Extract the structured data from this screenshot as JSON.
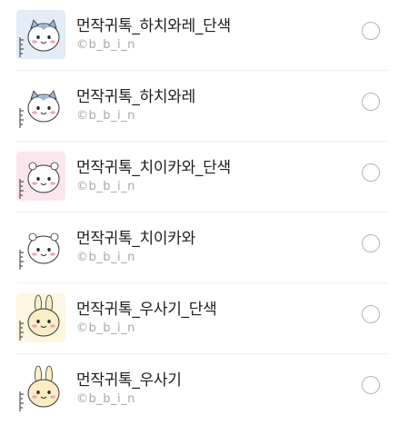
{
  "list": {
    "items": [
      {
        "title": "먼작귀톡_하치와레_단색",
        "author": "©b_b_i_n",
        "character": "hachiware",
        "thumb_bg": "#e3ecf7",
        "selected": false
      },
      {
        "title": "먼작귀톡_하치와레",
        "author": "©b_b_i_n",
        "character": "hachiware",
        "thumb_bg": "#ffffff",
        "selected": false
      },
      {
        "title": "먼작귀톡_치이카와_단색",
        "author": "©b_b_i_n",
        "character": "chiikawa",
        "thumb_bg": "#fbe6ec",
        "selected": false
      },
      {
        "title": "먼작귀톡_치이카와",
        "author": "©b_b_i_n",
        "character": "chiikawa",
        "thumb_bg": "#ffffff",
        "selected": false
      },
      {
        "title": "먼작귀톡_우사기_단색",
        "author": "©b_b_i_n",
        "character": "usagi",
        "thumb_bg": "#fdf6e0",
        "selected": false
      },
      {
        "title": "먼작귀톡_우사기",
        "author": "©b_b_i_n",
        "character": "usagi",
        "thumb_bg": "#ffffff",
        "selected": false
      }
    ]
  },
  "colors": {
    "cheek": "#f4a6b6",
    "eye": "#2a2a2a",
    "hachiware_ear": "#9ab7d9",
    "usagi_body": "#fbeec6",
    "ruler": "#555555"
  }
}
